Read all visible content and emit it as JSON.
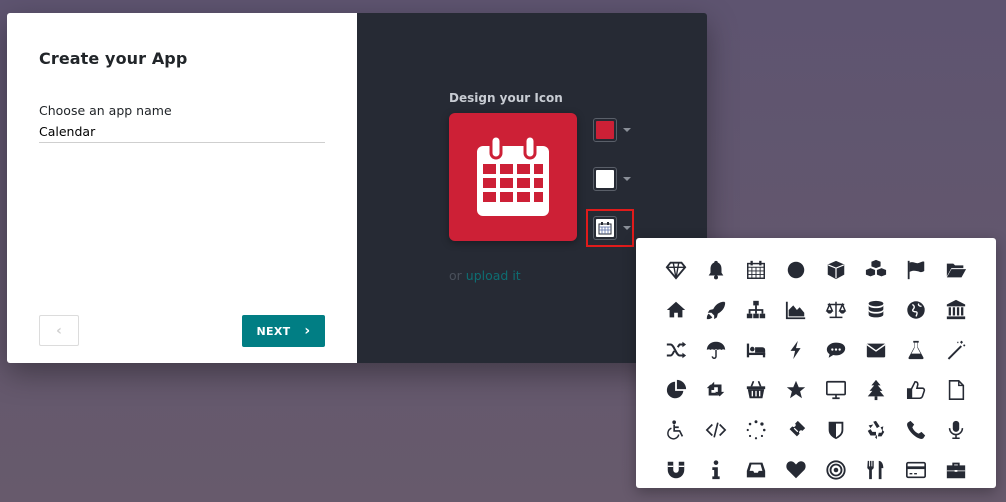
{
  "dialog": {
    "title": "Create your App",
    "app_name_label": "Choose an app name",
    "app_name_value": "Calendar",
    "previous_icon": "‹",
    "next_label": "NEXT",
    "next_icon": "›"
  },
  "designer": {
    "label": "Design your Icon",
    "background_color": "#cd2036",
    "icon_color": "#ffffff",
    "selected_icon": "calendar",
    "upload_prefix": "or",
    "upload_link": "upload it"
  },
  "colors": {
    "accent": "#017e84",
    "panel_dark": "#262a34",
    "highlight_border": "#e01b1b"
  },
  "icon_picker": {
    "icons": [
      "diamond",
      "bell",
      "calendar",
      "circle",
      "cube",
      "cubes",
      "flag",
      "folder-open",
      "home",
      "rocket",
      "sitemap",
      "area-chart",
      "balance-scale",
      "database",
      "globe",
      "university",
      "random",
      "umbrella",
      "bed",
      "bolt",
      "commenting",
      "envelope",
      "flask",
      "magic",
      "pie-chart",
      "retweet",
      "shopping-basket",
      "star",
      "desktop",
      "tree",
      "thumbs-o-up",
      "file-o",
      "wheelchair",
      "code",
      "circle-o-notch",
      "ticket",
      "shield",
      "recycle",
      "phone",
      "microphone",
      "magnet",
      "info",
      "inbox",
      "heart",
      "bullseye",
      "cutlery",
      "credit-card",
      "briefcase"
    ]
  }
}
